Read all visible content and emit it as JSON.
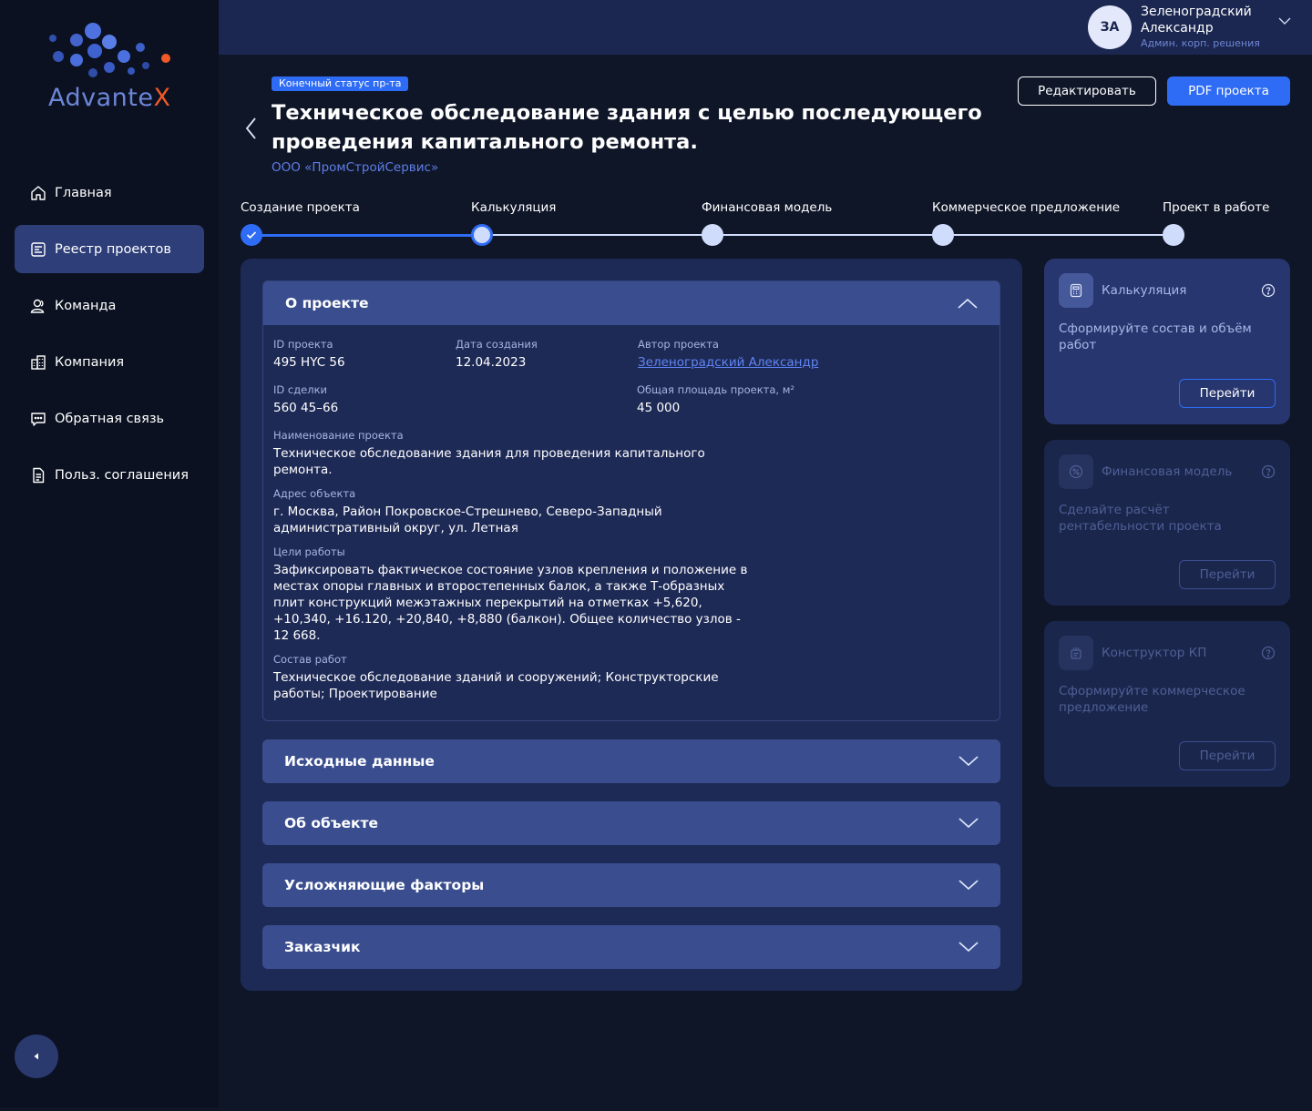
{
  "brand": {
    "name_main": "Advante",
    "name_accent": "X"
  },
  "sidebar": {
    "items": [
      {
        "label": "Главная",
        "icon": "home-icon"
      },
      {
        "label": "Реестр проектов",
        "icon": "registry-icon",
        "active": true
      },
      {
        "label": "Команда",
        "icon": "team-icon"
      },
      {
        "label": "Компания",
        "icon": "building-icon"
      },
      {
        "label": "Обратная связь",
        "icon": "chat-icon"
      },
      {
        "label": "Польз. соглашения",
        "icon": "document-icon"
      }
    ]
  },
  "user": {
    "initials": "ЗА",
    "name": "Зеленоградский Александр",
    "role": "Админ. корп. решения"
  },
  "project": {
    "status_badge": "Конечный статус пр-та",
    "title": "Техническое обследование здания с целью последующего проведения капитального ремонта.",
    "company": "ООО «ПромСтройСервис»"
  },
  "actions": {
    "edit": "Редактировать",
    "pdf": "PDF проекта"
  },
  "stepper": {
    "steps": [
      {
        "label": "Создание проекта",
        "state": "done"
      },
      {
        "label": "Калькуляция",
        "state": "current"
      },
      {
        "label": "Финансовая модель",
        "state": "pending"
      },
      {
        "label": "Коммерческое предложение",
        "state": "pending"
      },
      {
        "label": "Проект в работе",
        "state": "pending"
      }
    ]
  },
  "about": {
    "title": "О проекте",
    "id_label": "ID проекта",
    "id_value": "495 HYC 56",
    "date_label": "Дата создания",
    "date_value": "12.04.2023",
    "author_label": "Автор проекта",
    "author_value": "Зеленоградский Александр",
    "deal_label": "ID сделки",
    "deal_value": "560 45–66",
    "area_label": "Общая площадь проекта, м²",
    "area_value": "45 000",
    "name_label": "Наименование проекта",
    "name_value": "Техническое обследование здания для проведения капитального ремонта.",
    "address_label": "Адрес объекта",
    "address_value": "г. Москва, Район Покровское-Стрешнево, Северо-Западный административный округ, ул. Летная",
    "goals_label": "Цели работы",
    "goals_value": "Зафиксировать фактическое состояние узлов крепления и положение в местах опоры главных и второстепенных балок, а также Т-образных плит конструкций межэтажных перекрытий на отметках +5,620, +10,340, +16.120, +20,840, +8,880 (балкон). Общее количество узлов - 12 668.",
    "scope_label": "Состав работ",
    "scope_value": "Техническое обследование зданий и сооружений; Конструкторские работы; Проектирование"
  },
  "sections": [
    {
      "title": "Исходные данные"
    },
    {
      "title": "Об объекте"
    },
    {
      "title": "Усложняющие факторы"
    },
    {
      "title": "Заказчик"
    }
  ],
  "cards": [
    {
      "title": "Калькуляция",
      "desc": "Сформируйте состав и объём работ",
      "button": "Перейти",
      "enabled": true
    },
    {
      "title": "Финансовая модель",
      "desc": "Сделайте расчёт рентабельности проекта",
      "button": "Перейти",
      "enabled": false
    },
    {
      "title": "Конструктор КП",
      "desc": "Сформируйте коммерческое предложение",
      "button": "Перейти",
      "enabled": false
    }
  ],
  "colors": {
    "accent": "#2f6cf5",
    "brand_x": "#f05a28",
    "sidebar_bg": "#0b1120",
    "panel_bg": "#1e2a56"
  }
}
